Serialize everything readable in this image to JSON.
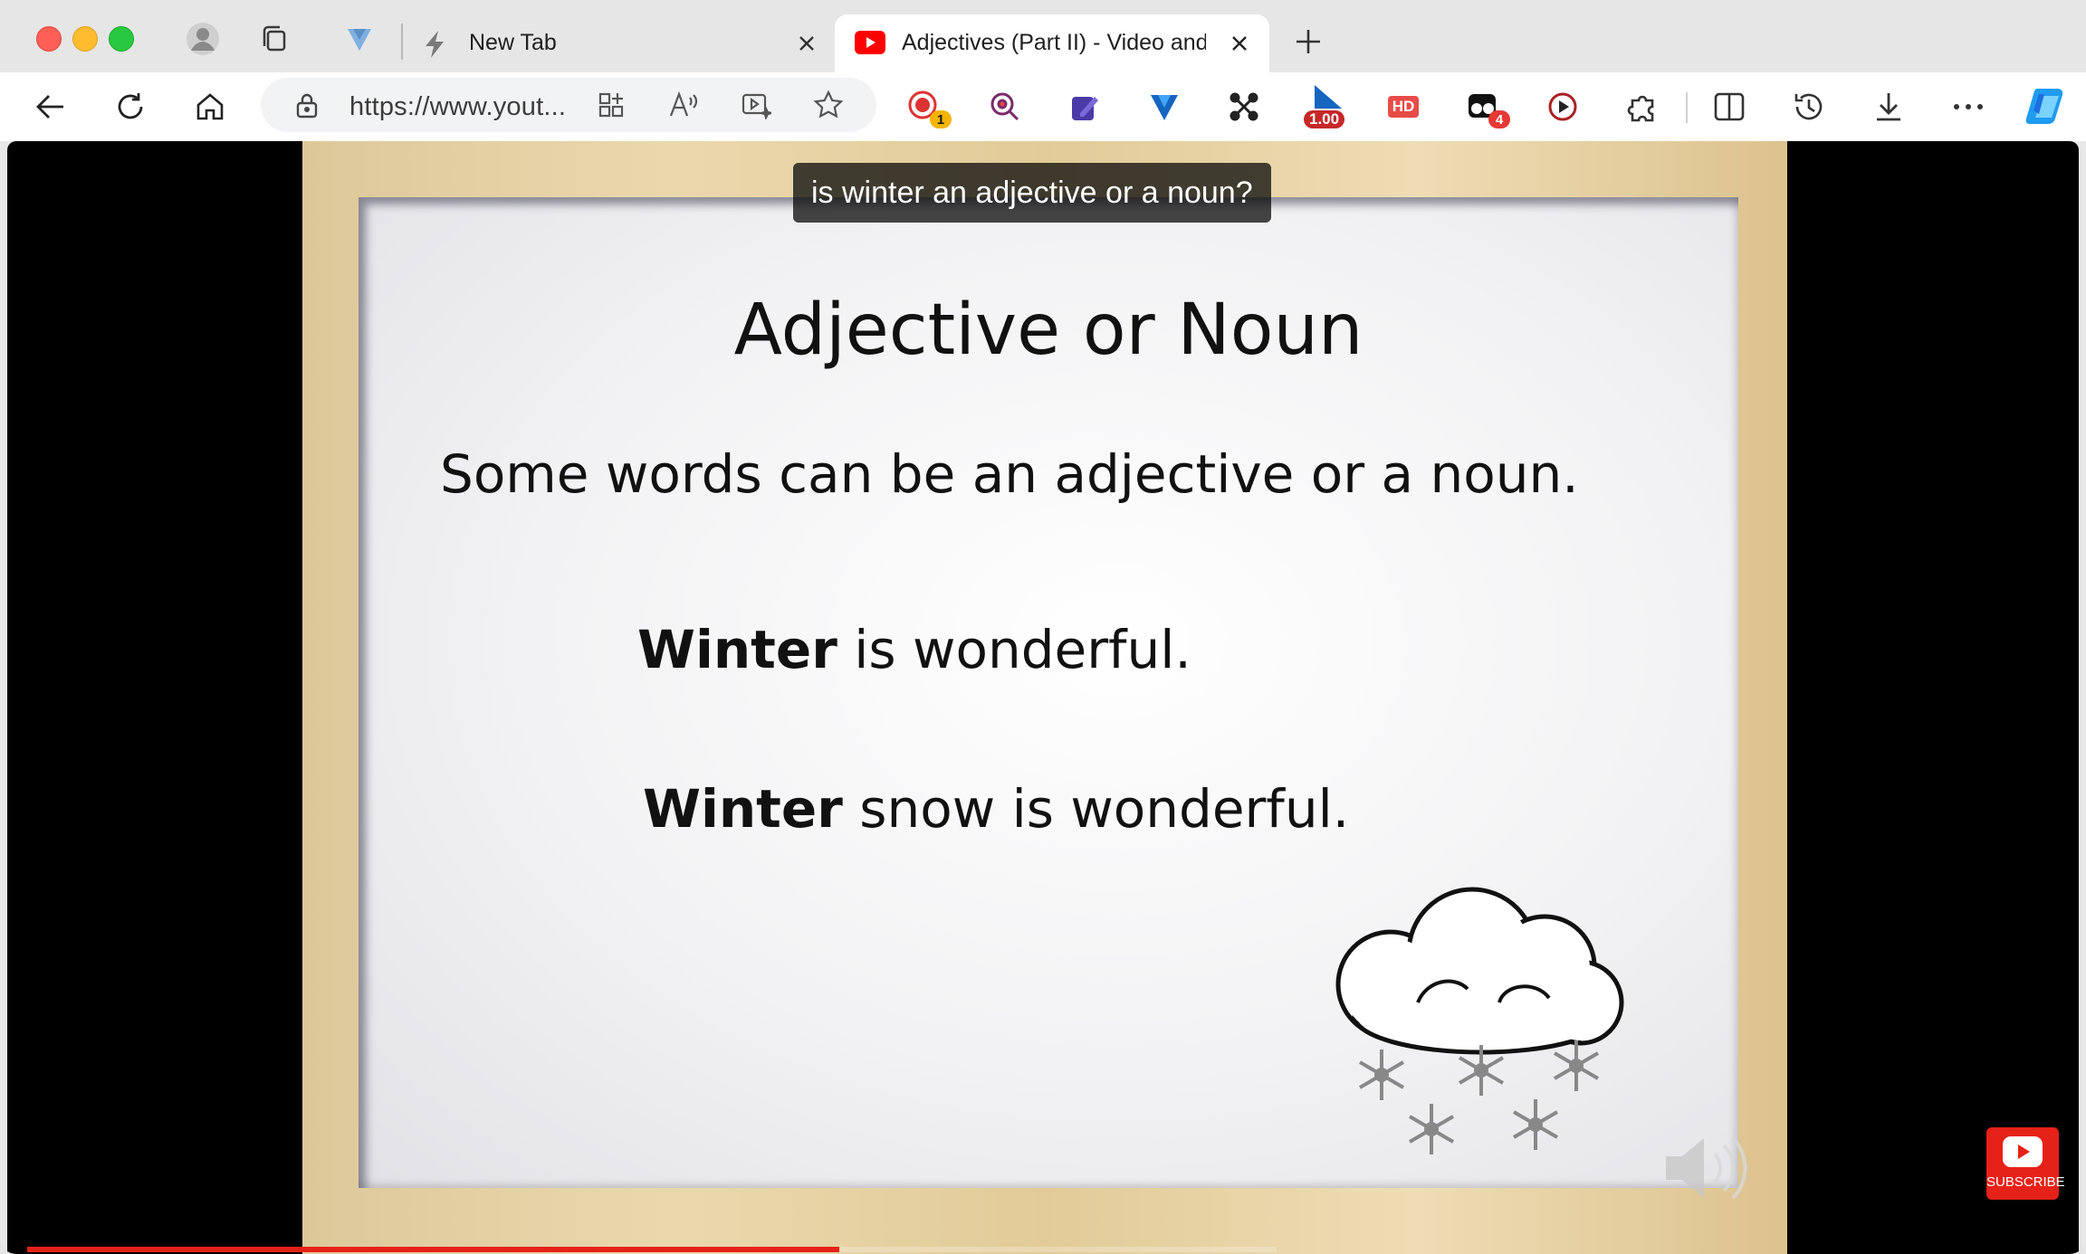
{
  "tabs": [
    {
      "title": "New Tab",
      "active": false
    },
    {
      "title": "Adjectives (Part II) - Video and Worksheet",
      "active": true
    }
  ],
  "address": {
    "url": "https://www.yout..."
  },
  "extensions": {
    "badge_record": "1",
    "badge_speed": "1.00",
    "badge_hd": "HD",
    "badge_count": "4"
  },
  "video": {
    "caption": "is winter an adjective or a noun?",
    "slide_title": "Adjective or Noun",
    "slide_line1": "Some words can be an adjective or a noun.",
    "example1_bold": "Winter",
    "example1_rest": " is wonderful.",
    "example2_bold": "Winter",
    "example2_rest": " snow is wonderful.",
    "subscribe_label": "SUBSCRIBE",
    "progress": 0.65
  },
  "colors": {
    "youtube_red": "#e62117",
    "accent": "#1a73e8"
  }
}
